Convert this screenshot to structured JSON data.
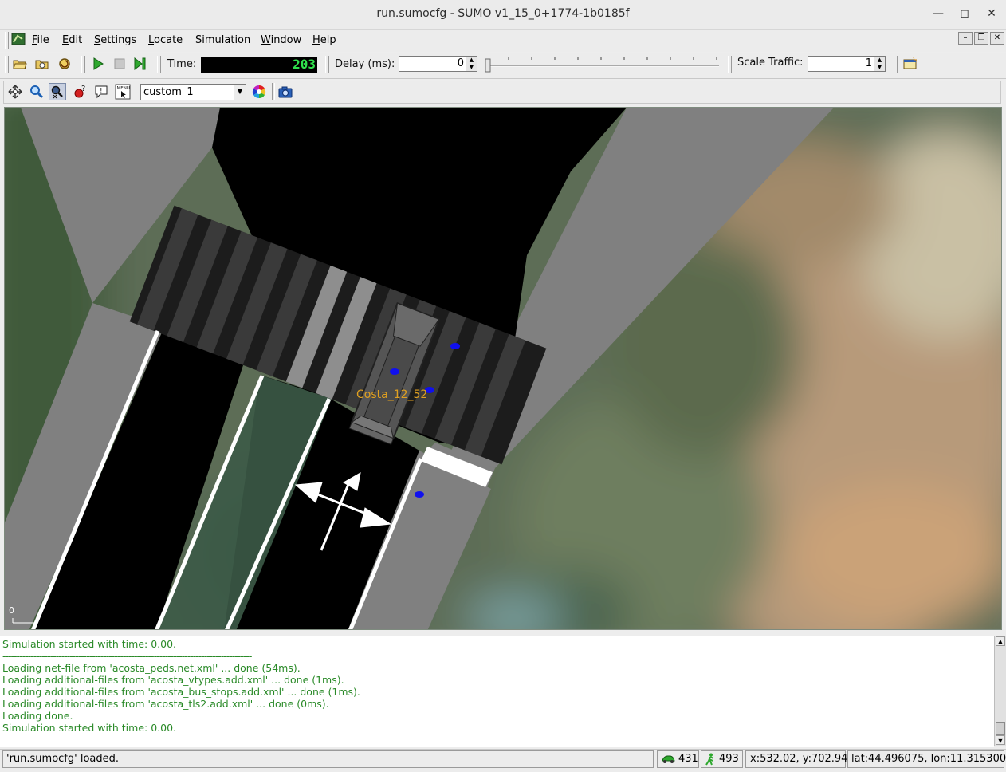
{
  "window": {
    "title": "run.sumocfg - SUMO v1_15_0+1774-1b0185f",
    "controls": [
      "minimize-icon",
      "maximize-icon",
      "close-icon"
    ]
  },
  "menubar": {
    "items": [
      {
        "label": "File",
        "mnemonic": "F",
        "rest": "ile"
      },
      {
        "label": "Edit",
        "mnemonic": "E",
        "rest": "dit"
      },
      {
        "label": "Settings",
        "mnemonic": "S",
        "rest": "ettings"
      },
      {
        "label": "Locate",
        "mnemonic": "L",
        "rest": "ocate"
      },
      {
        "label": "Simulation",
        "mnemonic": "",
        "rest": "Simulation"
      },
      {
        "label": "Window",
        "mnemonic": "W",
        "rest": "indow"
      },
      {
        "label": "Help",
        "mnemonic": "H",
        "rest": "elp"
      }
    ]
  },
  "toolbar": {
    "time_label": "Time:",
    "time_value": "203",
    "delay_label": "Delay (ms):",
    "delay_value": "0",
    "scale_label": "Scale Traffic:",
    "scale_value": "1"
  },
  "view_toolbar": {
    "scheme": "custom_1"
  },
  "view": {
    "vehicle_label": "Costa_12_52",
    "scale_origin": "0"
  },
  "messages": [
    "Simulation started with time: 0.00.",
    "-----------------------------------------------------------------------------------------",
    "Loading net-file from 'acosta_peds.net.xml' ... done (54ms).",
    "Loading additional-files from 'acosta_vtypes.add.xml' ... done (1ms).",
    "Loading additional-files from 'acosta_bus_stops.add.xml' ... done (1ms).",
    "Loading additional-files from 'acosta_tls2.add.xml' ... done (0ms).",
    "Loading done.",
    "Simulation started with time: 0.00."
  ],
  "statusbar": {
    "status_text": "'run.sumocfg' loaded.",
    "vehicle_count": "431",
    "person_count": "493",
    "cursor_xy": "x:532.02, y:702.94",
    "cursor_geo": "lat:44.496075, lon:11.315300"
  },
  "colors": {
    "message_text": "#2a8a28",
    "time_digits": "#2fe04c",
    "vehicle_label": "#e0a020",
    "pedestrian": "#1010ee"
  }
}
